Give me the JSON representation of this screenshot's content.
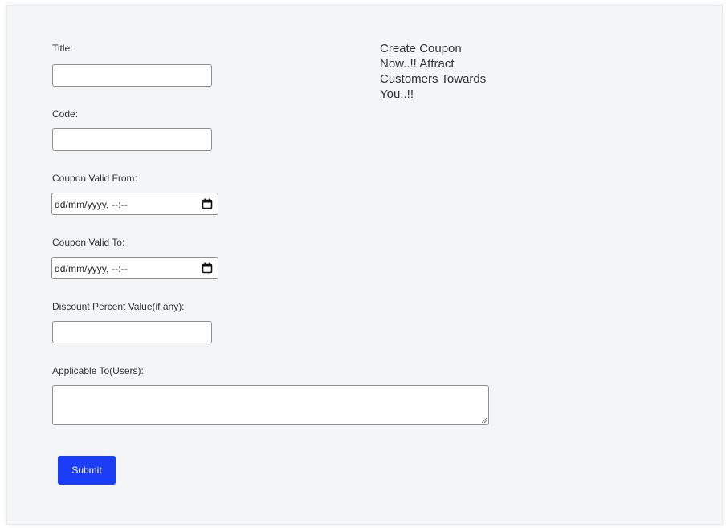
{
  "form": {
    "title_label": "Title:",
    "title_value": "",
    "code_label": "Code:",
    "code_value": "",
    "valid_from_label": "Coupon Valid From:",
    "valid_from_value": "dd/mm/yyyy, --:--",
    "valid_to_label": "Coupon Valid To:",
    "valid_to_value": "dd/mm/yyyy, --:--",
    "discount_label": "Discount Percent Value(if any):",
    "discount_value": "",
    "applicable_label": "Applicable To(Users):",
    "applicable_value": "",
    "submit_label": "Submit"
  },
  "promo": {
    "line1": "Create Coupon",
    "line2": "Now..!! Attract",
    "line3": "Customers Towards",
    "line4": "You..!!"
  },
  "icons": {
    "calendar": "calendar-icon",
    "resize": "resize-grip-icon"
  },
  "colors": {
    "submit_bg": "#1a3df5",
    "card_bg": "#f4f5f7"
  }
}
